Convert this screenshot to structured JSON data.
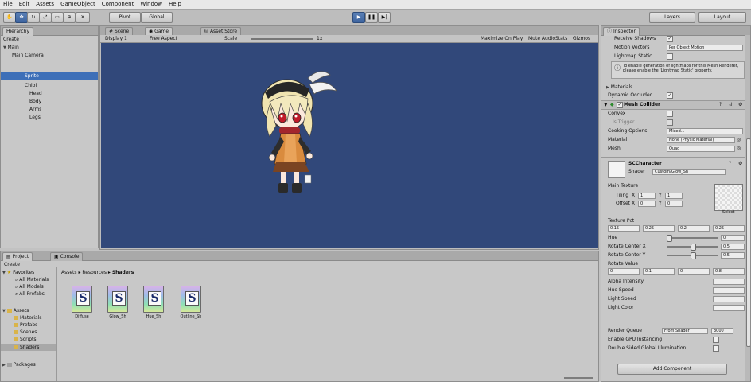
{
  "menu": [
    "File",
    "Edit",
    "Assets",
    "GameObject",
    "Component",
    "Window",
    "Help"
  ],
  "toolbar": {
    "pivot_label": "Pivot",
    "global_label": "Global",
    "play_icon": "play-icon",
    "pause_icon": "pause-icon",
    "step_icon": "step-icon",
    "layers_label": "Layers",
    "layout_label": "Layout"
  },
  "hierarchy": {
    "tab": "Hierarchy",
    "create": "Create",
    "scene": "Main",
    "items": [
      "Main Camera",
      "Sprite",
      "Chibi",
      "Head",
      "Body",
      "Arms",
      "Legs"
    ],
    "selected": "Sprite"
  },
  "scene_tabs": [
    "Scene",
    "Game",
    "Asset Store"
  ],
  "game_toolbar": {
    "display": "Display 1",
    "aspect": "Free Aspect",
    "scale_label": "Scale",
    "scale_value": "1x",
    "maximize": "Maximize On Play",
    "mute": "Mute Audio",
    "stats": "Stats",
    "gizmos": "Gizmos"
  },
  "colors": {
    "game_bg": "#31487a",
    "selection": "#3d6fb8",
    "accent_play": "#4a78c0"
  },
  "project": {
    "tabs": [
      "Project",
      "Console"
    ],
    "create": "Create",
    "favorites_label": "Favorites",
    "favorites": [
      "All Materials",
      "All Models",
      "All Prefabs"
    ],
    "assets_label": "Assets",
    "folders": [
      "Materials",
      "Prefabs",
      "Scenes",
      "Scripts",
      "Shaders"
    ],
    "packages_label": "Packages",
    "breadcrumb": [
      "Assets",
      "Resources",
      "Shaders"
    ],
    "shaders": [
      "Diffuse",
      "Glow_Sh",
      "Hue_Sh",
      "Outline_Sh"
    ]
  },
  "inspector": {
    "tab": "Inspector",
    "receive_shadows": "Receive Shadows",
    "motion_vectors": "Motion Vectors",
    "motion_value": "Per Object Motion",
    "lightmap_static": "Lightmap Static",
    "info_text": "To enable generation of lightmaps for this Mesh Renderer, please enable the 'Lightmap Static' property.",
    "materials": "Materials",
    "dynamic_occluded": "Dynamic Occluded",
    "component_title": "Mesh Collider",
    "convex": "Convex",
    "is_trigger": "Is Trigger",
    "cooking_options": "Cooking Options",
    "cooking_value": "Mixed...",
    "material": "Material",
    "material_value": "None (Physic Material)",
    "mesh": "Mesh",
    "mesh_value": "Quad",
    "shader_name": "SCCharacter",
    "shader_label": "Shader",
    "shader_value": "Custom/Glow_Sh",
    "main_texture": "Main Texture",
    "tiling": "Tiling",
    "offset": "Offset",
    "select_label": "Select",
    "texture_pct": "Texture Pct",
    "hue": "Hue",
    "rotate_center_x": "Rotate Center X",
    "rotate_center_y": "Rotate Center Y",
    "rotate_value": "Rotate Value",
    "alpha_intensity": "Alpha Intensity",
    "hue_speed": "Hue Speed",
    "light_speed": "Light Speed",
    "light_color": "Light Color",
    "render_queue": "Render Queue",
    "render_queue_mode": "From Shader",
    "render_queue_value": "3000",
    "enable_gpu_instancing": "Enable GPU Instancing",
    "double_sided": "Double Sided Global Illumination",
    "add_component": "Add Component",
    "vals": {
      "tiling_x": "1",
      "tiling_y": "1",
      "offset_x": "0",
      "offset_y": "0",
      "pct_a": "0.15",
      "pct_b": "0.25",
      "pct_c": "0.2",
      "pct_d": "0.25",
      "hue": "0",
      "rcx": "0.5",
      "rcy": "0.5",
      "rv_a": "0",
      "rv_b": "0.1",
      "rv_c": "0",
      "rv_d": "0.8"
    }
  }
}
